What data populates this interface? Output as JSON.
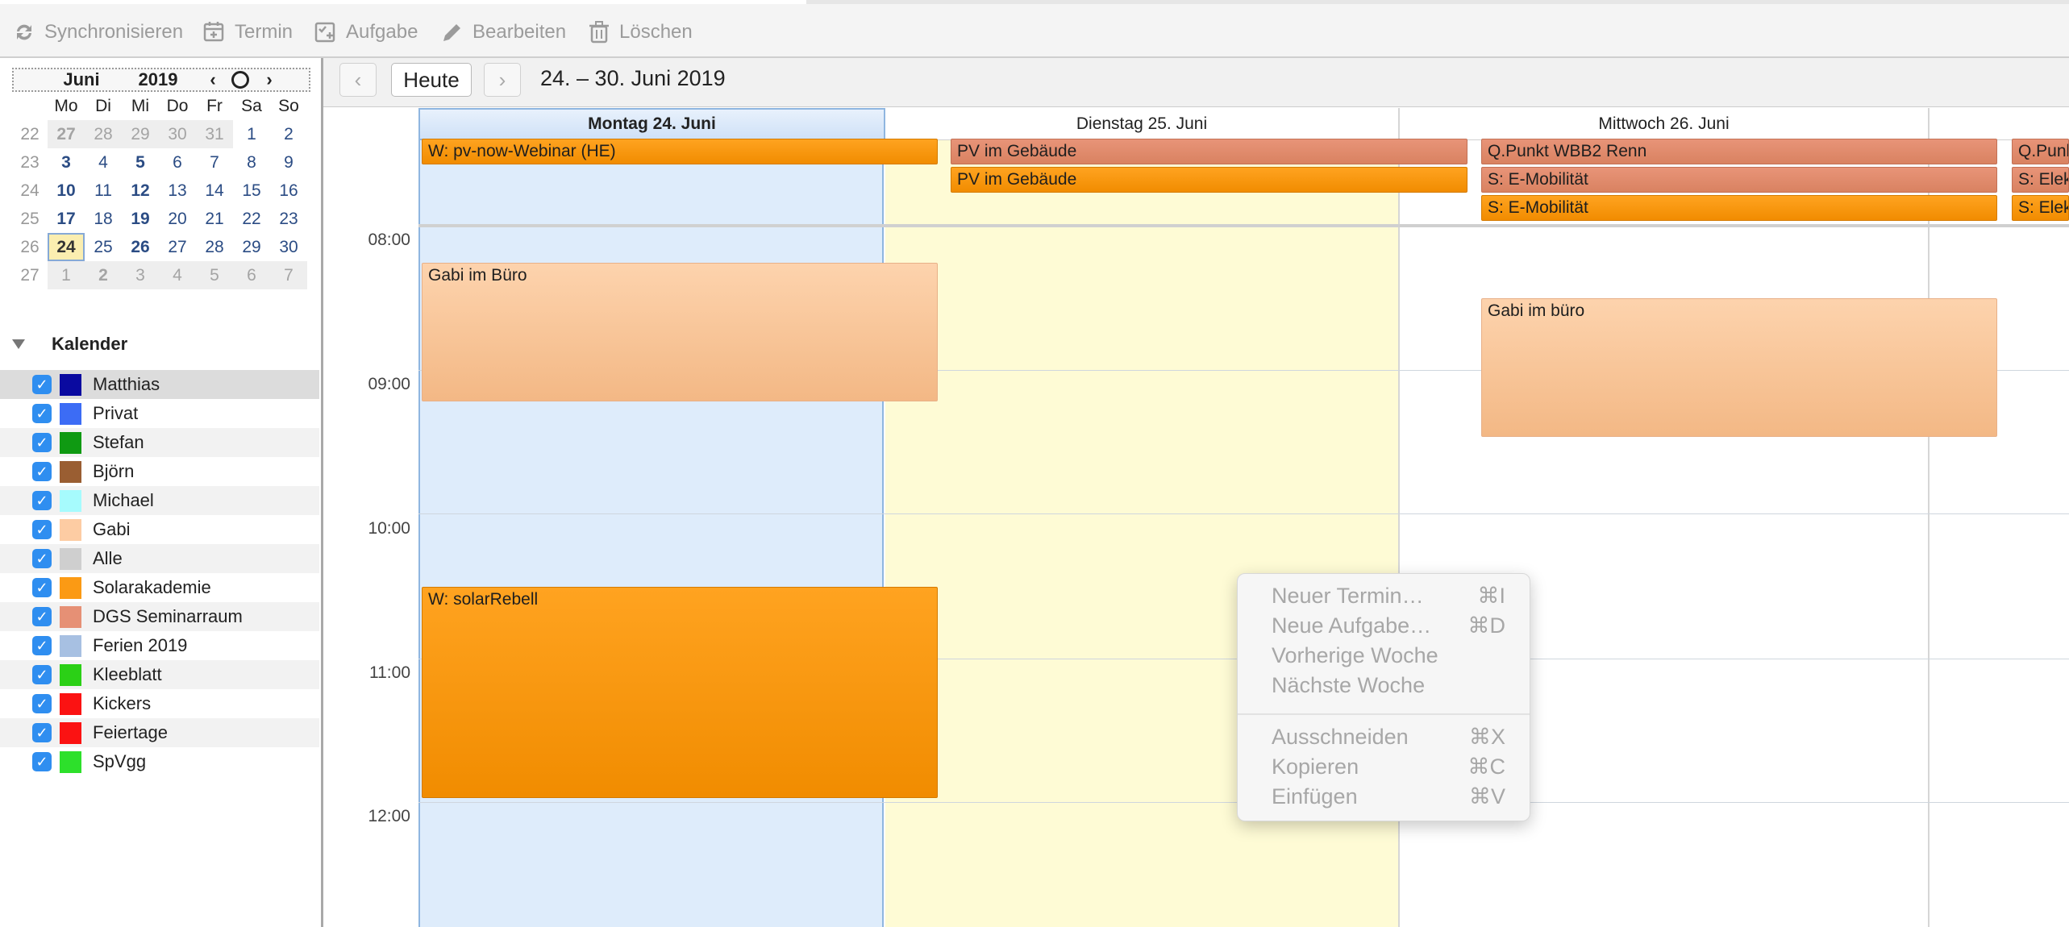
{
  "toolbar": {
    "buttons": [
      {
        "label": "Synchronisieren",
        "icon": "sync-icon"
      },
      {
        "label": "Termin",
        "icon": "new-event-icon"
      },
      {
        "label": "Aufgabe",
        "icon": "new-task-icon"
      },
      {
        "label": "Bearbeiten",
        "icon": "pencil-icon"
      },
      {
        "label": "Löschen",
        "icon": "trash-icon"
      }
    ]
  },
  "minical": {
    "month": "Juni",
    "year": "2019",
    "weekday_names": [
      "Mo",
      "Di",
      "Mi",
      "Do",
      "Fr",
      "Sa",
      "So"
    ],
    "weeks": [
      {
        "wn": "22",
        "days": [
          "27",
          "28",
          "29",
          "30",
          "31",
          "1",
          "2"
        ]
      },
      {
        "wn": "23",
        "days": [
          "3",
          "4",
          "5",
          "6",
          "7",
          "8",
          "9"
        ]
      },
      {
        "wn": "24",
        "days": [
          "10",
          "11",
          "12",
          "13",
          "14",
          "15",
          "16"
        ]
      },
      {
        "wn": "25",
        "days": [
          "17",
          "18",
          "19",
          "20",
          "21",
          "22",
          "23"
        ]
      },
      {
        "wn": "26",
        "days": [
          "24",
          "25",
          "26",
          "27",
          "28",
          "29",
          "30"
        ]
      },
      {
        "wn": "27",
        "days": [
          "1",
          "2",
          "3",
          "4",
          "5",
          "6",
          "7"
        ]
      }
    ]
  },
  "calendars": {
    "header": "Kalender",
    "items": [
      {
        "name": "Matthias",
        "color": "#0a0aa0"
      },
      {
        "name": "Privat",
        "color": "#3c6cf5"
      },
      {
        "name": "Stefan",
        "color": "#0f9a12"
      },
      {
        "name": "Björn",
        "color": "#9a5e32"
      },
      {
        "name": "Michael",
        "color": "#a6fbfd"
      },
      {
        "name": "Gabi",
        "color": "#fdcca3"
      },
      {
        "name": "Alle",
        "color": "#cfcfcf"
      },
      {
        "name": "Solarakademie",
        "color": "#fb9a14"
      },
      {
        "name": "DGS Seminarraum",
        "color": "#e69075"
      },
      {
        "name": "Ferien 2019",
        "color": "#a7c0e2"
      },
      {
        "name": "Kleeblatt",
        "color": "#2bd016"
      },
      {
        "name": "Kickers",
        "color": "#fb1212"
      },
      {
        "name": "Feiertage",
        "color": "#fb1212"
      },
      {
        "name": "SpVgg",
        "color": "#2de02b"
      }
    ]
  },
  "nav": {
    "today_label": "Heute",
    "range": "24. – 30. Juni 2019"
  },
  "days": [
    {
      "label": "Montag 24. Juni"
    },
    {
      "label": "Dienstag 25. Juni"
    },
    {
      "label": "Mittwoch 26. Juni"
    }
  ],
  "hours": [
    "08:00",
    "09:00",
    "10:00",
    "11:00",
    "12:00"
  ],
  "allday_events": {
    "mon": [
      "W: pv-now-Webinar (HE)"
    ],
    "tue": [
      "PV im Gebäude",
      "PV im Gebäude"
    ],
    "wed": [
      "Q.Punkt WBB2 Renn",
      "S: E-Mobilität",
      "S: E-Mobilität"
    ],
    "thu": [
      "Q.Punk",
      "S: Elek",
      "S: Elek"
    ]
  },
  "events": {
    "mon_gabi": "Gabi im Büro",
    "mon_solar": "W: solarRebell",
    "wed_gabi": "Gabi im büro"
  },
  "context_menu": {
    "items": [
      {
        "label": "Neuer Termin…",
        "shortcut": "⌘I"
      },
      {
        "label": "Neue Aufgabe…",
        "shortcut": "⌘D"
      },
      {
        "label": "Vorherige Woche",
        "shortcut": ""
      },
      {
        "label": "Nächste Woche",
        "shortcut": ""
      },
      {
        "label": "Ausschneiden",
        "shortcut": "⌘X"
      },
      {
        "label": "Kopieren",
        "shortcut": "⌘C"
      },
      {
        "label": "Einfügen",
        "shortcut": "⌘V"
      }
    ]
  },
  "colors": {
    "selected_day_bg": "#deecfb",
    "other_day_bg": "#fefbd5",
    "accent": "#2f8ef0"
  }
}
